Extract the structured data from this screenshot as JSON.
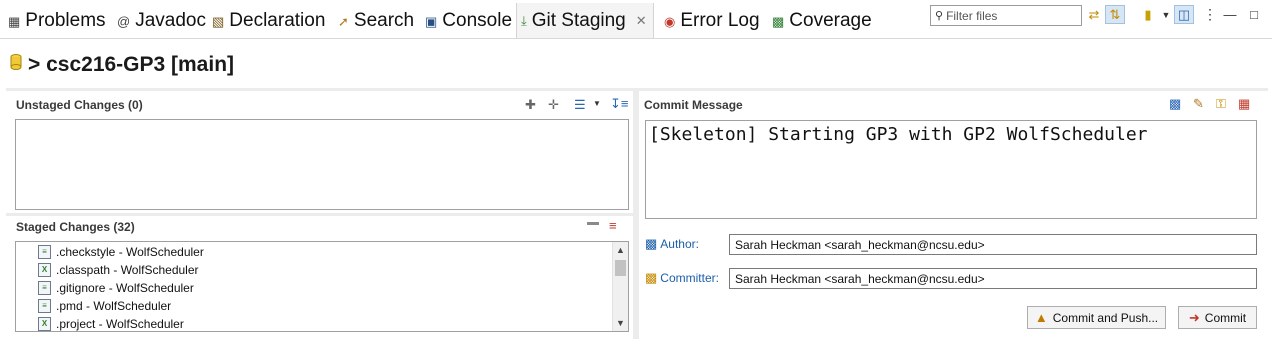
{
  "tabs": [
    {
      "label": "Problems",
      "icon": "problems-icon"
    },
    {
      "label": "Javadoc",
      "icon": "javadoc-icon"
    },
    {
      "label": "Declaration",
      "icon": "declaration-icon"
    },
    {
      "label": "Search",
      "icon": "search-icon"
    },
    {
      "label": "Console",
      "icon": "console-icon"
    },
    {
      "label": "Git Staging",
      "icon": "git-staging-icon",
      "active": true
    },
    {
      "label": "Error Log",
      "icon": "error-log-icon"
    },
    {
      "label": "Coverage",
      "icon": "coverage-icon"
    }
  ],
  "toolbar": {
    "filter_placeholder": "Filter files"
  },
  "repo": {
    "title": "> csc216-GP3 [main]"
  },
  "unstaged": {
    "title": "Unstaged Changes (0)",
    "files": []
  },
  "staged": {
    "title": "Staged Changes (32)",
    "files": [
      {
        "name": ".checkstyle - WolfScheduler",
        "icon": "text-file-icon"
      },
      {
        "name": ".classpath - WolfScheduler",
        "icon": "xml-file-icon"
      },
      {
        "name": ".gitignore - WolfScheduler",
        "icon": "text-file-icon"
      },
      {
        "name": ".pmd - WolfScheduler",
        "icon": "text-file-icon"
      },
      {
        "name": ".project - WolfScheduler",
        "icon": "xml-file-icon"
      }
    ]
  },
  "commit": {
    "title": "Commit Message",
    "message": "[Skeleton] Starting GP3 with GP2 WolfScheduler",
    "author_label": "Author:",
    "author_value": "Sarah Heckman <sarah_heckman@ncsu.edu>",
    "committer_label": "Committer:",
    "committer_value": "Sarah Heckman <sarah_heckman@ncsu.edu>",
    "commit_and_push_label": "Commit and Push...",
    "commit_label": "Commit"
  },
  "colors": {
    "link_blue": "#1b5fa8",
    "active_tab_bg": "#f4f4f4"
  }
}
